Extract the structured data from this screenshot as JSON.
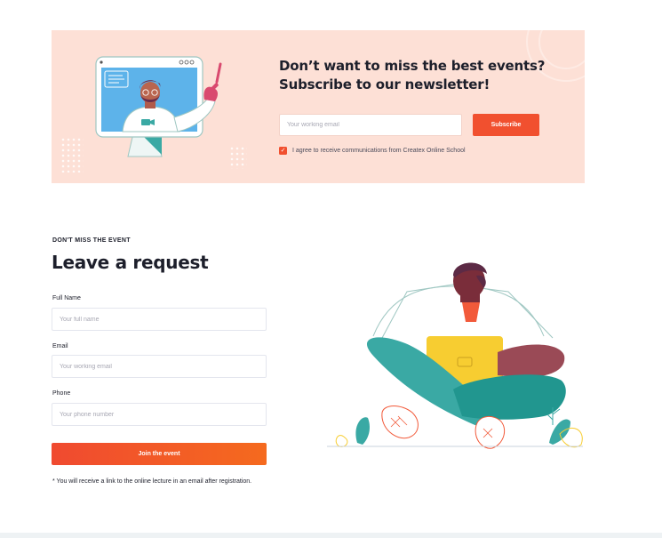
{
  "newsletter": {
    "heading_line1": "Don’t want to miss the best events?",
    "heading_line2": "Subscribe to our newsletter!",
    "email_placeholder": "Your working email",
    "subscribe_label": "Subscribe",
    "agree_text": "I agree to receive communications from Createx Online School",
    "agree_checked": true
  },
  "request": {
    "eyebrow": "DON'T MISS THE EVENT",
    "title": "Leave a request",
    "fields": [
      {
        "label": "Full Name",
        "placeholder": "Your full name"
      },
      {
        "label": "Email",
        "placeholder": "Your working email"
      },
      {
        "label": "Phone",
        "placeholder": "Your phone number"
      }
    ],
    "join_label": "Join the event",
    "note": "* You will receive a link to the online lecture in an email after registration."
  },
  "colors": {
    "accent": "#f1502f",
    "banner_bg": "#fde0d6",
    "heading": "#1d1f2b",
    "teal": "#3aa9a4",
    "yellow": "#f7cd31"
  },
  "icons": [
    "checkbox-checked-icon",
    "video-camera-icon"
  ]
}
